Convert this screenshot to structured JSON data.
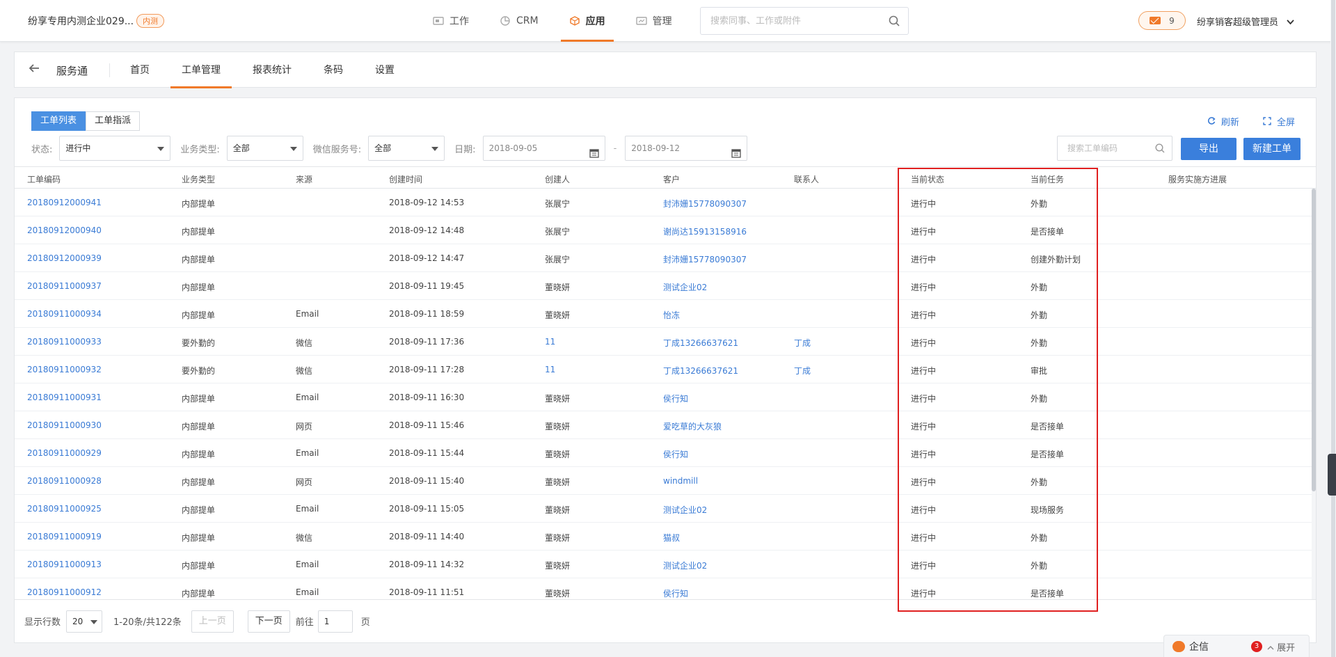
{
  "topbar": {
    "company": "纷享专用内测企业029...",
    "company_badge": "内测",
    "nav": [
      {
        "label": "工作",
        "icon": "work-icon"
      },
      {
        "label": "CRM",
        "icon": "crm-pie-icon"
      },
      {
        "label": "应用",
        "icon": "app-cube-icon"
      },
      {
        "label": "管理",
        "icon": "manage-icon"
      }
    ],
    "search_placeholder": "搜索同事、工作或附件",
    "message_count": "9",
    "user": "纷享销客超级管理员"
  },
  "subnav": {
    "app_name": "服务通",
    "tabs": [
      "首页",
      "工单管理",
      "报表统计",
      "条码",
      "设置"
    ],
    "active_tab": "工单管理"
  },
  "panel": {
    "view_tabs": [
      "工单列表",
      "工单指派"
    ],
    "tools": {
      "refresh": "刷新",
      "fullscreen": "全屏"
    },
    "filters": {
      "status_label": "状态:",
      "status_value": "进行中",
      "biz_label": "业务类型:",
      "biz_value": "全部",
      "wechat_label": "微信服务号:",
      "wechat_value": "全部",
      "date_label": "日期:",
      "date_from": "2018-09-05",
      "date_to": "2018-09-12",
      "date_sep": "-"
    },
    "search_placeholder": "搜索工单编码",
    "export_label": "导出",
    "new_label": "新建工单"
  },
  "table": {
    "headers": [
      "工单编码",
      "业务类型",
      "来源",
      "创建时间",
      "创建人",
      "客户",
      "联系人",
      "当前状态",
      "当前任务",
      "服务实施方进展"
    ],
    "rows": [
      [
        "20180912000941",
        "内部提单",
        "",
        "2018-09-12 14:53",
        "张展宁",
        "封沛姗15778090307",
        "",
        "进行中",
        "外勤"
      ],
      [
        "20180912000940",
        "内部提单",
        "",
        "2018-09-12 14:48",
        "张展宁",
        "谢尚达15913158916",
        "",
        "进行中",
        "是否接单"
      ],
      [
        "20180912000939",
        "内部提单",
        "",
        "2018-09-12 14:47",
        "张展宁",
        "封沛姗15778090307",
        "",
        "进行中",
        "创建外勤计划"
      ],
      [
        "20180911000937",
        "内部提单",
        "",
        "2018-09-11 19:45",
        "董晓妍",
        "测试企业02",
        "",
        "进行中",
        "外勤"
      ],
      [
        "20180911000934",
        "内部提单",
        "Email",
        "2018-09-11 18:59",
        "董晓妍",
        "怡冻",
        "",
        "进行中",
        "外勤"
      ],
      [
        "20180911000933",
        "要外勤的",
        "微信",
        "2018-09-11 17:36",
        "11",
        "丁成13266637621",
        "丁成",
        "进行中",
        "外勤"
      ],
      [
        "20180911000932",
        "要外勤的",
        "微信",
        "2018-09-11 17:28",
        "11",
        "丁成13266637621",
        "丁成",
        "进行中",
        "审批"
      ],
      [
        "20180911000931",
        "内部提单",
        "Email",
        "2018-09-11 16:30",
        "董晓妍",
        "侯行知",
        "",
        "进行中",
        "外勤"
      ],
      [
        "20180911000930",
        "内部提单",
        "网页",
        "2018-09-11 15:46",
        "董晓妍",
        "爱吃草的大灰狼",
        "",
        "进行中",
        "是否接单"
      ],
      [
        "20180911000929",
        "内部提单",
        "Email",
        "2018-09-11 15:44",
        "董晓妍",
        "侯行知",
        "",
        "进行中",
        "是否接单"
      ],
      [
        "20180911000928",
        "内部提单",
        "网页",
        "2018-09-11 15:40",
        "董晓妍",
        "windmill",
        "",
        "进行中",
        "外勤"
      ],
      [
        "20180911000925",
        "内部提单",
        "Email",
        "2018-09-11 15:05",
        "董晓妍",
        "测试企业02",
        "",
        "进行中",
        "现场服务"
      ],
      [
        "20180911000919",
        "内部提单",
        "微信",
        "2018-09-11 14:40",
        "董晓妍",
        "猫叔",
        "",
        "进行中",
        "外勤"
      ],
      [
        "20180911000913",
        "内部提单",
        "Email",
        "2018-09-11 14:32",
        "董晓妍",
        "测试企业02",
        "",
        "进行中",
        "外勤"
      ],
      [
        "20180911000912",
        "内部提单",
        "Email",
        "2018-09-11 11:51",
        "董晓妍",
        "侯行知",
        "",
        "进行中",
        "是否接单"
      ]
    ],
    "creator_link_rows": [
      5,
      6
    ]
  },
  "pager": {
    "rows_label": "显示行数",
    "rows_value": "20",
    "total": "1-20条/共122条",
    "prev": "上一页",
    "next": "下一页",
    "goto_label": "前往",
    "page_value": "1",
    "page_suffix": "页"
  },
  "chat": {
    "label": "企信",
    "badge": "3",
    "expand": "展开"
  },
  "colors": {
    "accent": "#f07a2a",
    "link": "#3a7bd5",
    "primary_button": "#3a7fdc",
    "highlight_box": "#e02020"
  }
}
